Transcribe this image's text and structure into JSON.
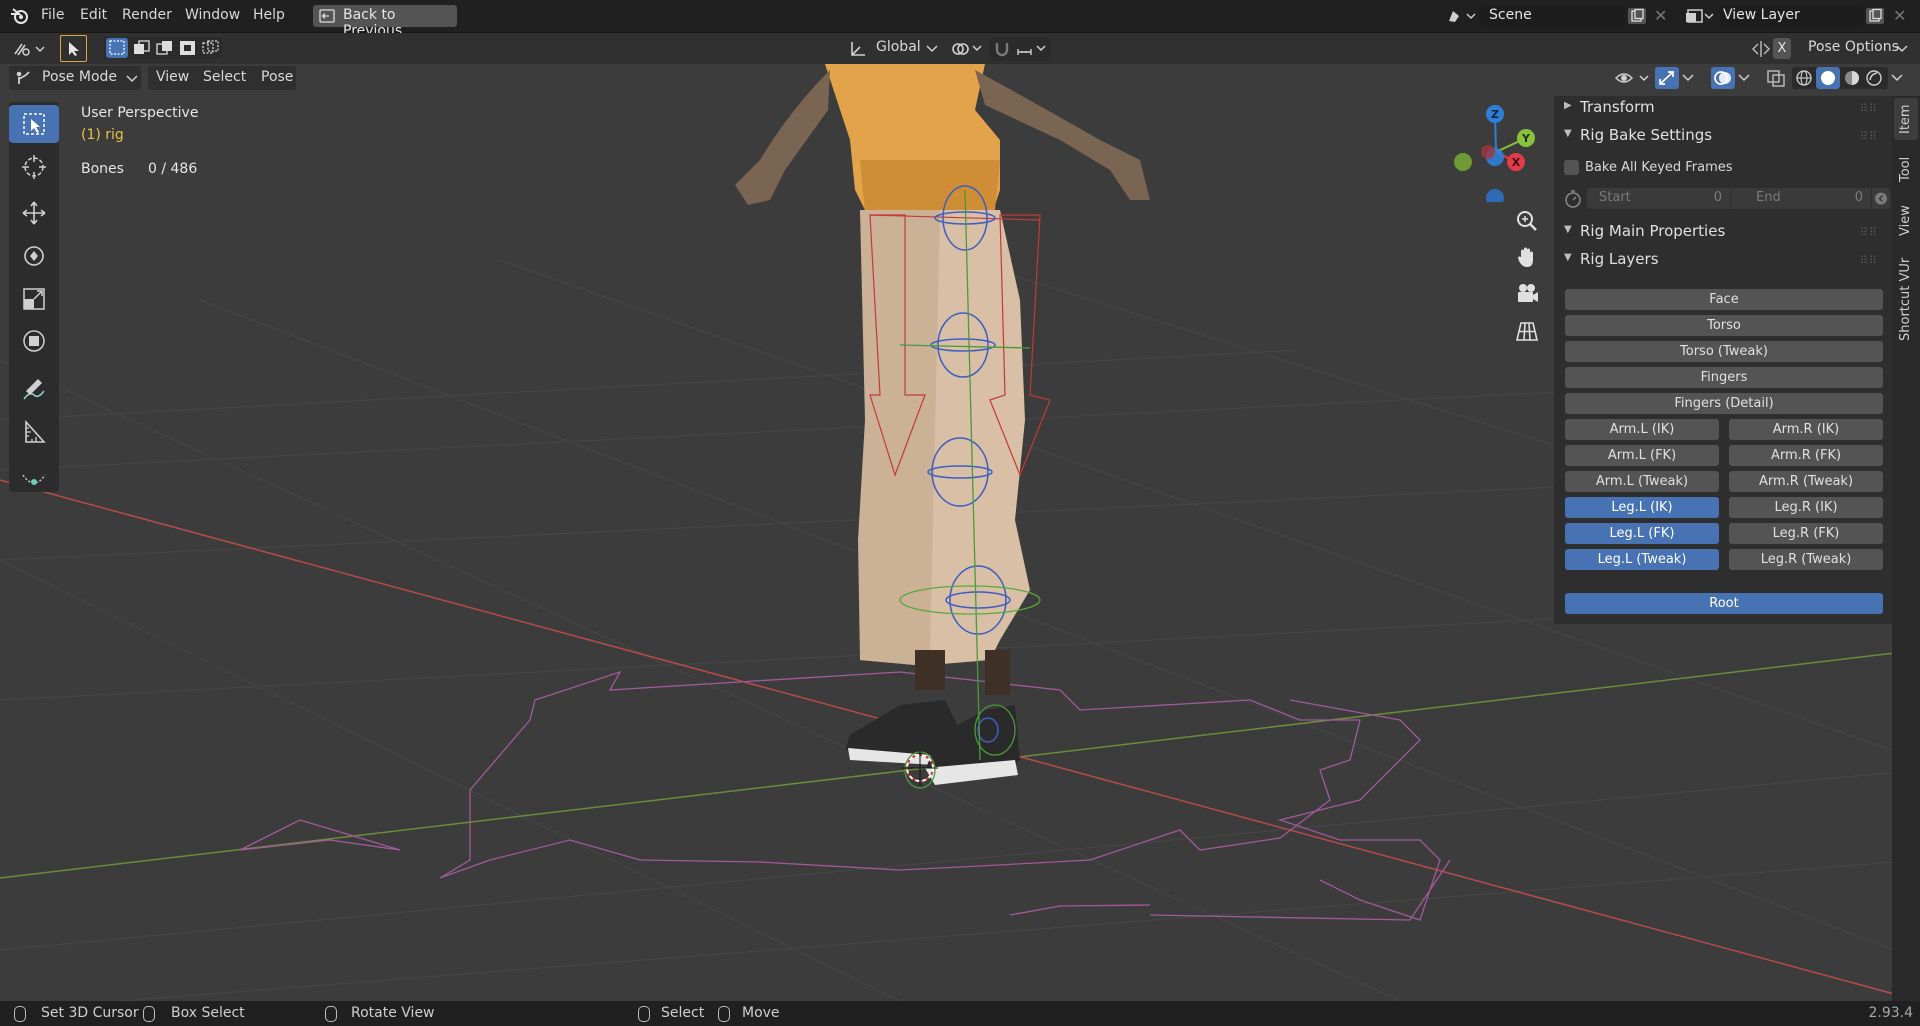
{
  "menu": [
    "File",
    "Edit",
    "Render",
    "Window",
    "Help"
  ],
  "back_button": "Back to Previous",
  "scene": {
    "value": "Scene"
  },
  "view_layer": {
    "value": "View Layer"
  },
  "toolbar": {
    "transform_orientation": "Global",
    "pose_options": "Pose Options",
    "x_mirror": "X"
  },
  "header": {
    "mode": "Pose Mode",
    "menus": [
      "View",
      "Select",
      "Pose"
    ]
  },
  "overlay_text": {
    "perspective": "User Perspective",
    "object": "(1) rig",
    "bones_label": "Bones",
    "bones_value": "0 / 486"
  },
  "gizmo": {
    "z": "Z",
    "y": "Y",
    "x": "X"
  },
  "npanel": {
    "transform": "Transform",
    "rig_bake_settings": "Rig Bake Settings",
    "bake_all_keyed_frames": "Bake All Keyed Frames",
    "start_label": "Start",
    "start_value": "0",
    "end_label": "End",
    "end_value": "0",
    "rig_main_properties": "Rig Main Properties",
    "rig_layers": "Rig Layers",
    "single_buttons": [
      "Face",
      "Torso",
      "Torso (Tweak)",
      "Fingers",
      "Fingers (Detail)"
    ],
    "pair_buttons": [
      {
        "left": "Arm.L (IK)",
        "right": "Arm.R (IK)",
        "left_on": false,
        "right_on": false
      },
      {
        "left": "Arm.L (FK)",
        "right": "Arm.R (FK)",
        "left_on": false,
        "right_on": false
      },
      {
        "left": "Arm.L (Tweak)",
        "right": "Arm.R (Tweak)",
        "left_on": false,
        "right_on": false
      },
      {
        "left": "Leg.L (IK)",
        "right": "Leg.R (IK)",
        "left_on": true,
        "right_on": false
      },
      {
        "left": "Leg.L (FK)",
        "right": "Leg.R (FK)",
        "left_on": true,
        "right_on": false
      },
      {
        "left": "Leg.L (Tweak)",
        "right": "Leg.R (Tweak)",
        "left_on": true,
        "right_on": false
      }
    ],
    "root": "Root"
  },
  "side_tabs": [
    "Item",
    "Tool",
    "View",
    "Shortcut VUr"
  ],
  "status": {
    "set_cursor": "Set 3D Cursor",
    "box_select": "Box Select",
    "rotate_view": "Rotate View",
    "select": "Select",
    "move": "Move",
    "version": "2.93.4"
  },
  "colors": {
    "accent": "#4772b3",
    "axis_x": "#e03c4a",
    "axis_y": "#8ac13a",
    "axis_z": "#2f7fd8",
    "object_name": "#e6c340"
  }
}
